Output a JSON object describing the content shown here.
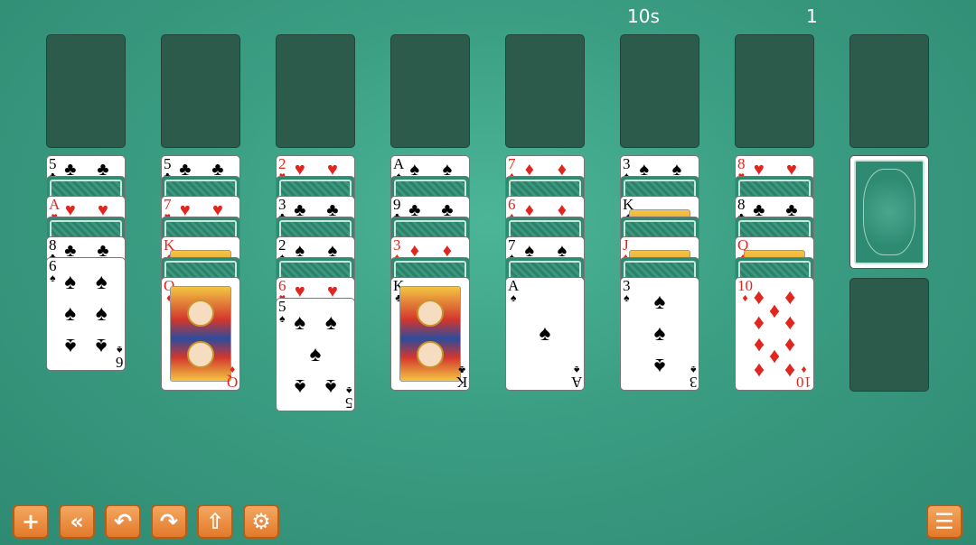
{
  "hud": {
    "timer": "10s",
    "moves": "1"
  },
  "colors": {
    "felt": "#3a9d82",
    "empty_slot": "#2c5a4b",
    "button": "#e8893a",
    "red_suit": "#e0261f"
  },
  "foundations": [
    {},
    {},
    {},
    {},
    {},
    {},
    {}
  ],
  "stock": {
    "state": "face-down"
  },
  "waste": {
    "state": "empty"
  },
  "tableau": [
    {
      "cards": [
        {
          "type": "up",
          "rank": "5",
          "suit": "♣",
          "color": "black"
        },
        {
          "type": "down"
        },
        {
          "type": "up",
          "rank": "A",
          "suit": "♥",
          "color": "red"
        },
        {
          "type": "down"
        },
        {
          "type": "up",
          "rank": "8",
          "suit": "♣",
          "color": "black"
        },
        {
          "type": "full",
          "rank": "6",
          "suit": "♠",
          "color": "black",
          "pips": 6
        }
      ]
    },
    {
      "cards": [
        {
          "type": "up",
          "rank": "5",
          "suit": "♣",
          "color": "black"
        },
        {
          "type": "down"
        },
        {
          "type": "up",
          "rank": "7",
          "suit": "♥",
          "color": "red"
        },
        {
          "type": "down"
        },
        {
          "type": "up",
          "rank": "K",
          "suit": "♦",
          "color": "red",
          "face": true
        },
        {
          "type": "down"
        },
        {
          "type": "full",
          "rank": "Q",
          "suit": "♦",
          "color": "red",
          "face": true
        }
      ]
    },
    {
      "cards": [
        {
          "type": "up",
          "rank": "2",
          "suit": "♥",
          "color": "red"
        },
        {
          "type": "down"
        },
        {
          "type": "up",
          "rank": "3",
          "suit": "♣",
          "color": "black"
        },
        {
          "type": "down"
        },
        {
          "type": "up",
          "rank": "2",
          "suit": "♠",
          "color": "black"
        },
        {
          "type": "down"
        },
        {
          "type": "up",
          "rank": "6",
          "suit": "♥",
          "color": "red"
        },
        {
          "type": "full",
          "rank": "5",
          "suit": "♠",
          "color": "black",
          "pips": 5
        }
      ]
    },
    {
      "cards": [
        {
          "type": "up",
          "rank": "A",
          "suit": "♠",
          "color": "black"
        },
        {
          "type": "down"
        },
        {
          "type": "up",
          "rank": "9",
          "suit": "♣",
          "color": "black"
        },
        {
          "type": "down"
        },
        {
          "type": "up",
          "rank": "3",
          "suit": "♦",
          "color": "red"
        },
        {
          "type": "down"
        },
        {
          "type": "full",
          "rank": "K",
          "suit": "♣",
          "color": "black",
          "face": true
        }
      ]
    },
    {
      "cards": [
        {
          "type": "up",
          "rank": "7",
          "suit": "♦",
          "color": "red"
        },
        {
          "type": "down"
        },
        {
          "type": "up",
          "rank": "6",
          "suit": "♦",
          "color": "red"
        },
        {
          "type": "down"
        },
        {
          "type": "up",
          "rank": "7",
          "suit": "♠",
          "color": "black"
        },
        {
          "type": "down"
        },
        {
          "type": "full",
          "rank": "A",
          "suit": "♠",
          "color": "black",
          "pips": 1
        }
      ]
    },
    {
      "cards": [
        {
          "type": "up",
          "rank": "3",
          "suit": "♠",
          "color": "black"
        },
        {
          "type": "down"
        },
        {
          "type": "up",
          "rank": "K",
          "suit": "♠",
          "color": "black",
          "face": true
        },
        {
          "type": "down"
        },
        {
          "type": "up",
          "rank": "J",
          "suit": "♦",
          "color": "red",
          "face": true
        },
        {
          "type": "down"
        },
        {
          "type": "full",
          "rank": "3",
          "suit": "♠",
          "color": "black",
          "pips": 3
        }
      ]
    },
    {
      "cards": [
        {
          "type": "up",
          "rank": "8",
          "suit": "♥",
          "color": "red"
        },
        {
          "type": "down"
        },
        {
          "type": "up",
          "rank": "8",
          "suit": "♣",
          "color": "black"
        },
        {
          "type": "down"
        },
        {
          "type": "up",
          "rank": "Q",
          "suit": "♦",
          "color": "red",
          "face": true
        },
        {
          "type": "down"
        },
        {
          "type": "full",
          "rank": "10",
          "suit": "♦",
          "color": "red",
          "pips": 10
        }
      ]
    }
  ],
  "toolbar": [
    {
      "icon": "plus-icon",
      "glyph": "+",
      "name": "new-game-button"
    },
    {
      "icon": "rewind-icon",
      "glyph": "«",
      "name": "restart-button"
    },
    {
      "icon": "undo-icon",
      "glyph": "↶",
      "name": "undo-button"
    },
    {
      "icon": "redo-icon",
      "glyph": "↷",
      "name": "redo-button"
    },
    {
      "icon": "arrow-up-icon",
      "glyph": "⇧",
      "name": "auto-complete-button"
    },
    {
      "icon": "gear-icon",
      "glyph": "⚙",
      "name": "settings-button"
    }
  ],
  "menu": {
    "icon": "list-icon",
    "glyph": "☰"
  }
}
